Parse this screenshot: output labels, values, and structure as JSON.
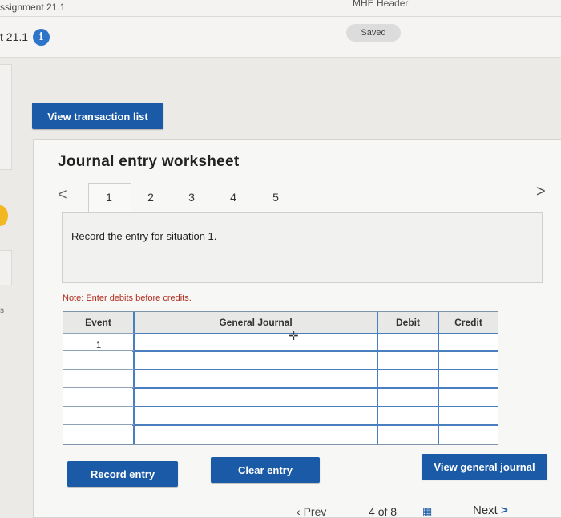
{
  "header": {
    "assignment_title": "ssignment 21.1",
    "mhe_header": "MHE Header",
    "subtitle": "t 21.1",
    "info_icon": "i",
    "saved_label": "Saved",
    "side_s": "s"
  },
  "buttons": {
    "view_transaction_list": "View transaction list",
    "record_entry": "Record entry",
    "clear_entry": "Clear entry",
    "view_general_journal": "View general journal"
  },
  "worksheet": {
    "title": "Journal entry worksheet",
    "prev_chevron": "<",
    "next_chevron": ">",
    "tabs": [
      "1",
      "2",
      "3",
      "4",
      "5"
    ],
    "active_tab": "1",
    "prompt": "Record the entry for situation 1.",
    "note": "Note: Enter debits before credits."
  },
  "journal_table": {
    "columns": [
      "Event",
      "General Journal",
      "Debit",
      "Credit"
    ],
    "rows": [
      {
        "event": "1",
        "account": "",
        "debit": "",
        "credit": ""
      },
      {
        "event": "",
        "account": "",
        "debit": "",
        "credit": ""
      },
      {
        "event": "",
        "account": "",
        "debit": "",
        "credit": ""
      },
      {
        "event": "",
        "account": "",
        "debit": "",
        "credit": ""
      },
      {
        "event": "",
        "account": "",
        "debit": "",
        "credit": ""
      },
      {
        "event": "",
        "account": "",
        "debit": "",
        "credit": ""
      }
    ]
  },
  "footer_nav": {
    "prev": "Prev",
    "page_current": "4",
    "page_of": "of",
    "page_total": "8",
    "next": "Next",
    "next_chevron": ">",
    "grid_icon": "▦"
  },
  "colors": {
    "primary_button": "#1a5aa6",
    "info_icon": "#2e74c8",
    "note_text": "#b12a1c",
    "grid_line": "#4a7fbf"
  }
}
